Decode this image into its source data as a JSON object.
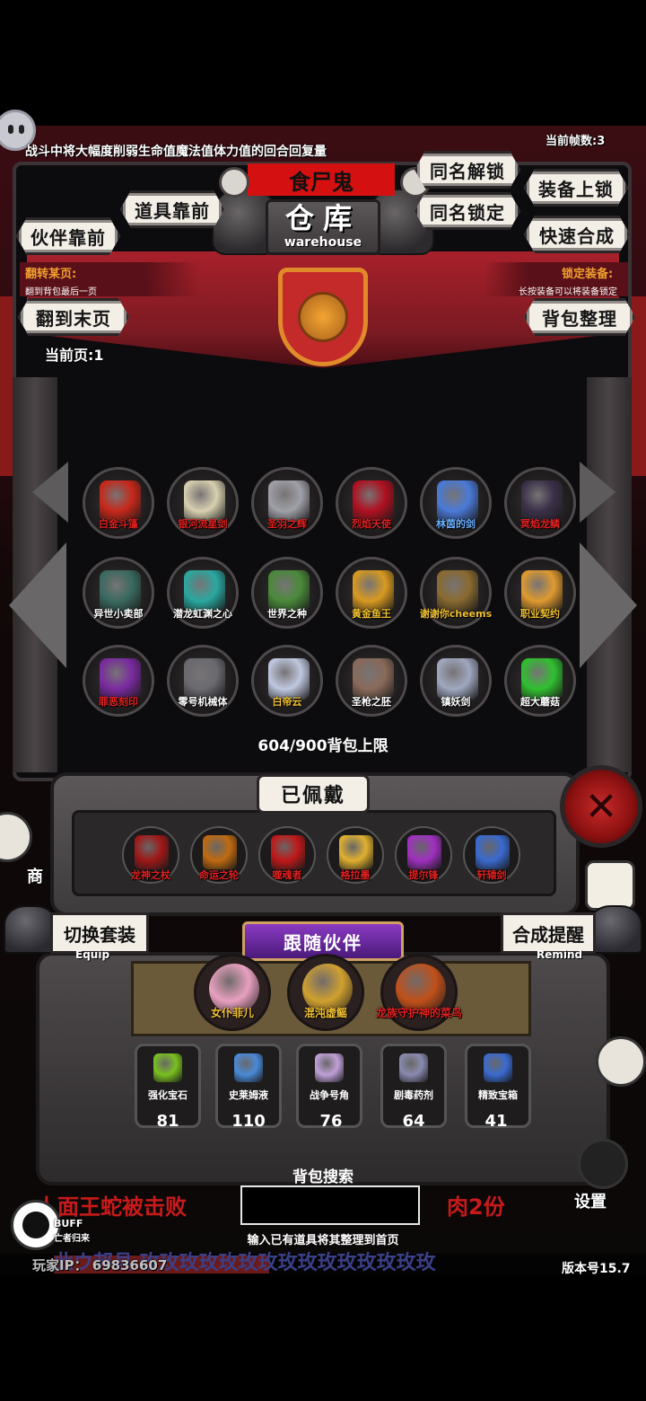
{
  "status_bar": {
    "combat_notice": "战斗中将大幅度削弱生命值魔法值体力值的回合回复量",
    "frame_rate": "当前帧数:3"
  },
  "header": {
    "monster_name": "食尸鬼",
    "title_cn": "仓库",
    "title_en": "warehouse"
  },
  "buttons": {
    "partner_front": "伙伴靠前",
    "item_front": "道具靠前",
    "same_name_unlock": "同名解锁",
    "same_name_lock": "同名锁定",
    "equip_unlock": "装备上锁",
    "quick_craft": "快速合成",
    "goto_last_page": "翻到末页",
    "sort_bag": "背包整理"
  },
  "info": {
    "flip_title": "翻转某页:",
    "flip_sub": "翻到背包最后一页",
    "lock_title": "锁定装备:",
    "lock_sub": "长按装备可以将装备锁定",
    "current_page": "当前页:1"
  },
  "inventory": {
    "items": [
      {
        "name": "白金斗篷",
        "color": "#c8281a",
        "label_color": "#e02020"
      },
      {
        "name": "银河流星剑",
        "color": "#d8d0b0",
        "label_color": "#e02020"
      },
      {
        "name": "圣羽之辉",
        "color": "#a0a0a8",
        "label_color": "#e02020"
      },
      {
        "name": "烈焰天使",
        "color": "#b01020",
        "label_color": "#e02020"
      },
      {
        "name": "林茵的剑",
        "color": "#4a7ad8",
        "label_color": "#6ab0ff"
      },
      {
        "name": "冥焰龙鳞",
        "color": "#3a3048",
        "label_color": "#e02020"
      },
      {
        "name": "异世小卖部",
        "color": "#3a6a60",
        "label_color": "#ffffff"
      },
      {
        "name": "潜龙虹渊之心",
        "color": "#2aa8a0",
        "label_color": "#ffffff"
      },
      {
        "name": "世界之种",
        "color": "#4a8a3a",
        "label_color": "#ffffff"
      },
      {
        "name": "黄金鱼王",
        "color": "#d89a20",
        "label_color": "#f0c030"
      },
      {
        "name": "谢谢你cheems",
        "color": "#8a6a30",
        "label_color": "#f0c030"
      },
      {
        "name": "职业契约",
        "color": "#e09a30",
        "label_color": "#f0c030"
      },
      {
        "name": "罪恶刻印",
        "color": "#7a2aa0",
        "label_color": "#e02020"
      },
      {
        "name": "零号机械体",
        "color": "#6a6a70",
        "label_color": "#ffffff"
      },
      {
        "name": "白帝云",
        "color": "#c0c8e0",
        "label_color": "#f0c030"
      },
      {
        "name": "圣枪之胚",
        "color": "#8a6a5a",
        "label_color": "#ffffff"
      },
      {
        "name": "镇妖剑",
        "color": "#a0a8c0",
        "label_color": "#ffffff"
      },
      {
        "name": "超大蘑菇",
        "color": "#30c030",
        "label_color": "#ffffff"
      }
    ],
    "capacity": "604/900背包上限"
  },
  "equipped": {
    "title": "已佩戴",
    "items": [
      {
        "name": "龙神之杖",
        "color": "#a01818",
        "label_color": "#e02020"
      },
      {
        "name": "命运之轮",
        "color": "#c06a10",
        "label_color": "#e02020"
      },
      {
        "name": "噬魂者",
        "color": "#c01818",
        "label_color": "#e02020"
      },
      {
        "name": "格拉墨",
        "color": "#e0b030",
        "label_color": "#e02020"
      },
      {
        "name": "提尔锋",
        "color": "#a030c0",
        "label_color": "#e02020"
      },
      {
        "name": "轩辕剑",
        "color": "#3a6ad0",
        "label_color": "#e02020"
      }
    ]
  },
  "companions": {
    "title": "跟随伙伴",
    "items": [
      {
        "name": "女仆菲儿",
        "color": "#e8a0c0",
        "label_color": "#f0c030"
      },
      {
        "name": "混沌虚鳐",
        "color": "#d0a030",
        "label_color": "#f0c030"
      },
      {
        "name": "龙族守护神的菜鸟",
        "color": "#c0501a",
        "label_color": "#e02020"
      }
    ]
  },
  "side_buttons": {
    "switch_set": "切换套装",
    "switch_sub": "Equip",
    "craft_remind": "合成提醒",
    "craft_sub": "Remind"
  },
  "materials": [
    {
      "name": "强化宝石",
      "count": "81",
      "color": "#7ac020"
    },
    {
      "name": "史莱姆液",
      "count": "110",
      "color": "#4a8ad8"
    },
    {
      "name": "战争号角",
      "count": "76",
      "color": "#c0a0d8"
    },
    {
      "name": "剧毒药剂",
      "count": "64",
      "color": "#8a8ab0"
    },
    {
      "name": "精致宝箱",
      "count": "41",
      "color": "#3a6ad0"
    }
  ],
  "search": {
    "label": "背包搜索",
    "value": "",
    "hint": "输入已有道具将其整理到首页"
  },
  "news": {
    "left": "人面王蛇被击败",
    "right": "肉2份",
    "scroll": "此ウ邦县 玫玫玫玫玫玫玫玫玫玫玫玫玫玫玫"
  },
  "footer": {
    "buff_label": "BUFF",
    "buff_sub": "亡者归来",
    "player_ip": "玩家IP：  69836607",
    "version": "版本号15.7"
  },
  "left_edge": {
    "shop_label": "商"
  },
  "right_edge": {
    "settings_label": "设置"
  }
}
